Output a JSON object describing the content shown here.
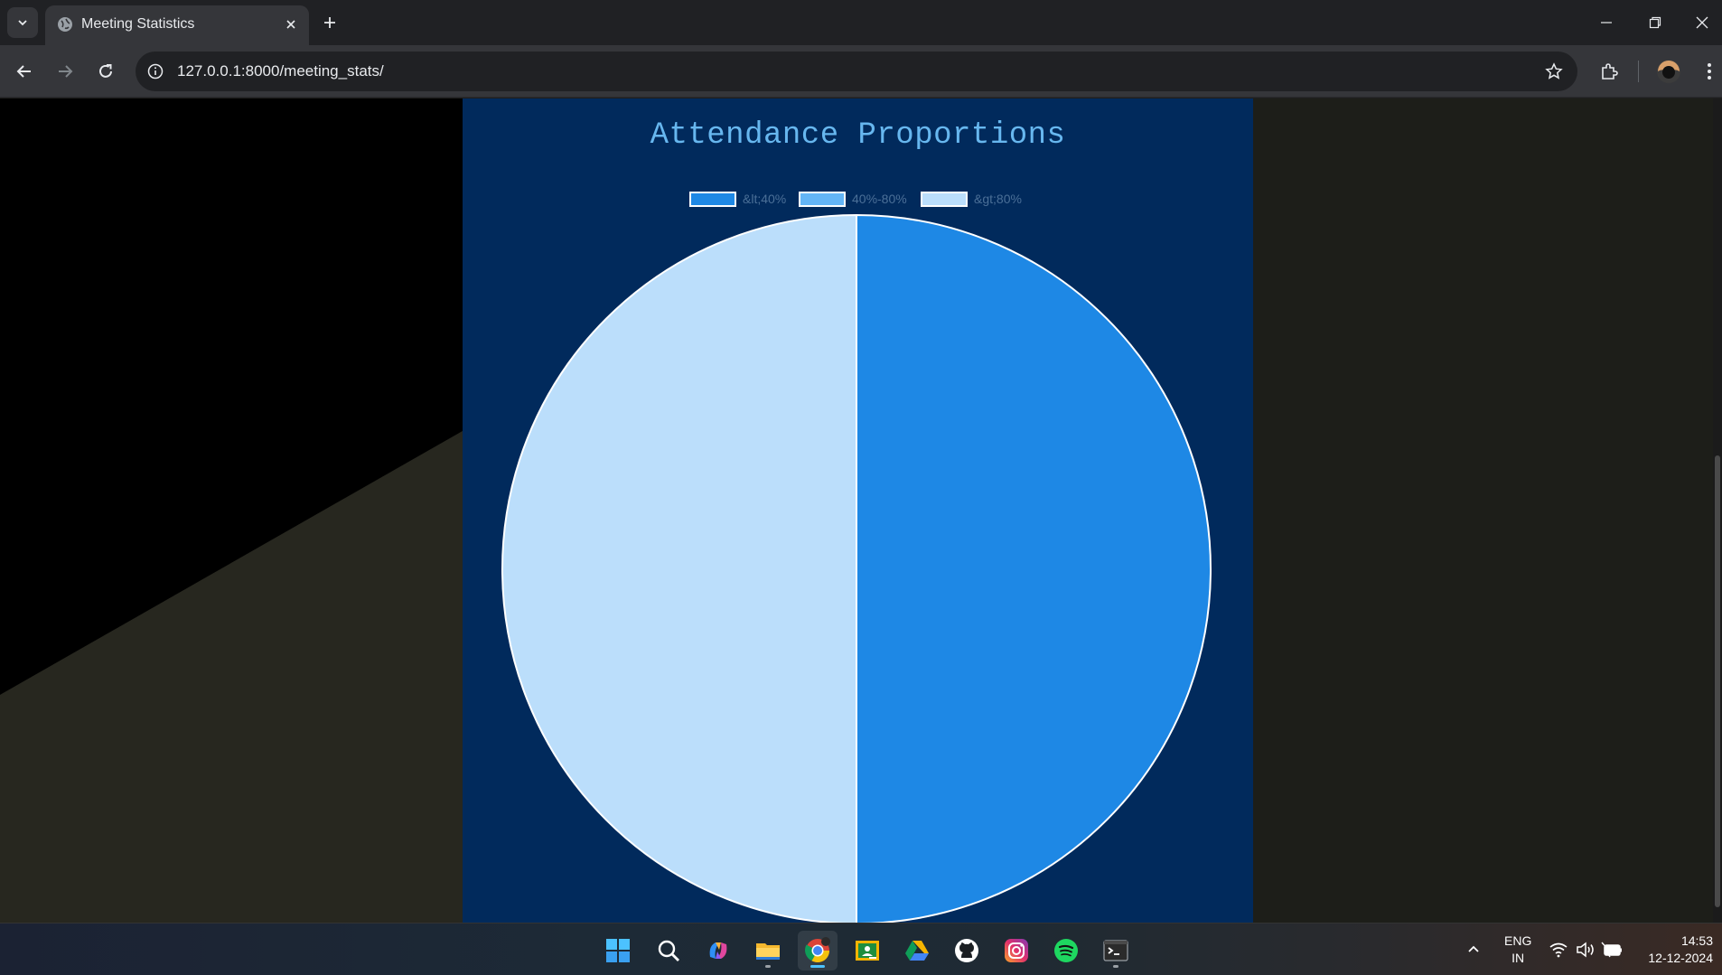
{
  "browser": {
    "tab_title": "Meeting Statistics",
    "url": "127.0.0.1:8000/meeting_stats/"
  },
  "chart": {
    "title": "Attendance Proportions",
    "legend": [
      {
        "label": "&lt;40%",
        "color": "#1e88e5"
      },
      {
        "label": "40%-80%",
        "color": "#64b5f6"
      },
      {
        "label": "&gt;80%",
        "color": "#bbdefb"
      }
    ]
  },
  "chart_data": {
    "type": "pie",
    "title": "Attendance Proportions",
    "categories": [
      "&lt;40%",
      "40%-80%",
      "&gt;80%"
    ],
    "values": [
      1,
      0,
      1
    ],
    "colors": [
      "#1e88e5",
      "#64b5f6",
      "#bbdefb"
    ],
    "legend_position": "top"
  },
  "taskbar": {
    "apps": [
      "start-icon",
      "search-icon",
      "copilot-icon",
      "file-explorer-icon",
      "chrome-icon",
      "google-classroom-icon",
      "google-drive-icon",
      "github-icon",
      "instagram-icon",
      "spotify-icon",
      "terminal-icon"
    ],
    "language": "ENG",
    "region": "IN",
    "time": "14:53",
    "date": "12-12-2024"
  }
}
